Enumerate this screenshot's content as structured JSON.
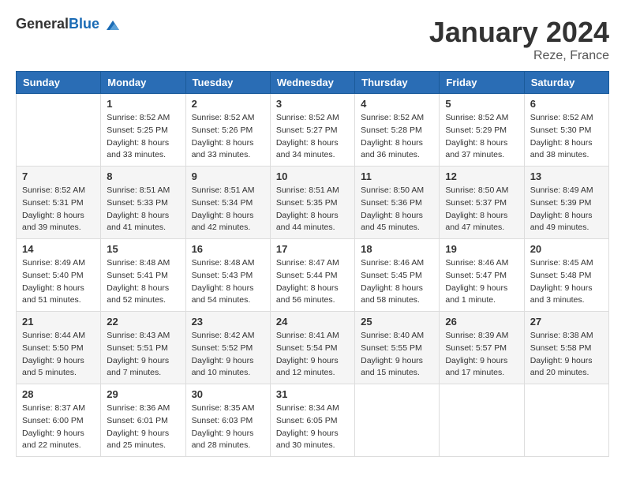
{
  "logo": {
    "general": "General",
    "blue": "Blue"
  },
  "title": "January 2024",
  "location": "Reze, France",
  "headers": [
    "Sunday",
    "Monday",
    "Tuesday",
    "Wednesday",
    "Thursday",
    "Friday",
    "Saturday"
  ],
  "weeks": [
    [
      {
        "day": "",
        "sunrise": "",
        "sunset": "",
        "daylight": ""
      },
      {
        "day": "1",
        "sunrise": "Sunrise: 8:52 AM",
        "sunset": "Sunset: 5:25 PM",
        "daylight": "Daylight: 8 hours and 33 minutes."
      },
      {
        "day": "2",
        "sunrise": "Sunrise: 8:52 AM",
        "sunset": "Sunset: 5:26 PM",
        "daylight": "Daylight: 8 hours and 33 minutes."
      },
      {
        "day": "3",
        "sunrise": "Sunrise: 8:52 AM",
        "sunset": "Sunset: 5:27 PM",
        "daylight": "Daylight: 8 hours and 34 minutes."
      },
      {
        "day": "4",
        "sunrise": "Sunrise: 8:52 AM",
        "sunset": "Sunset: 5:28 PM",
        "daylight": "Daylight: 8 hours and 36 minutes."
      },
      {
        "day": "5",
        "sunrise": "Sunrise: 8:52 AM",
        "sunset": "Sunset: 5:29 PM",
        "daylight": "Daylight: 8 hours and 37 minutes."
      },
      {
        "day": "6",
        "sunrise": "Sunrise: 8:52 AM",
        "sunset": "Sunset: 5:30 PM",
        "daylight": "Daylight: 8 hours and 38 minutes."
      }
    ],
    [
      {
        "day": "7",
        "sunrise": "Sunrise: 8:52 AM",
        "sunset": "Sunset: 5:31 PM",
        "daylight": "Daylight: 8 hours and 39 minutes."
      },
      {
        "day": "8",
        "sunrise": "Sunrise: 8:51 AM",
        "sunset": "Sunset: 5:33 PM",
        "daylight": "Daylight: 8 hours and 41 minutes."
      },
      {
        "day": "9",
        "sunrise": "Sunrise: 8:51 AM",
        "sunset": "Sunset: 5:34 PM",
        "daylight": "Daylight: 8 hours and 42 minutes."
      },
      {
        "day": "10",
        "sunrise": "Sunrise: 8:51 AM",
        "sunset": "Sunset: 5:35 PM",
        "daylight": "Daylight: 8 hours and 44 minutes."
      },
      {
        "day": "11",
        "sunrise": "Sunrise: 8:50 AM",
        "sunset": "Sunset: 5:36 PM",
        "daylight": "Daylight: 8 hours and 45 minutes."
      },
      {
        "day": "12",
        "sunrise": "Sunrise: 8:50 AM",
        "sunset": "Sunset: 5:37 PM",
        "daylight": "Daylight: 8 hours and 47 minutes."
      },
      {
        "day": "13",
        "sunrise": "Sunrise: 8:49 AM",
        "sunset": "Sunset: 5:39 PM",
        "daylight": "Daylight: 8 hours and 49 minutes."
      }
    ],
    [
      {
        "day": "14",
        "sunrise": "Sunrise: 8:49 AM",
        "sunset": "Sunset: 5:40 PM",
        "daylight": "Daylight: 8 hours and 51 minutes."
      },
      {
        "day": "15",
        "sunrise": "Sunrise: 8:48 AM",
        "sunset": "Sunset: 5:41 PM",
        "daylight": "Daylight: 8 hours and 52 minutes."
      },
      {
        "day": "16",
        "sunrise": "Sunrise: 8:48 AM",
        "sunset": "Sunset: 5:43 PM",
        "daylight": "Daylight: 8 hours and 54 minutes."
      },
      {
        "day": "17",
        "sunrise": "Sunrise: 8:47 AM",
        "sunset": "Sunset: 5:44 PM",
        "daylight": "Daylight: 8 hours and 56 minutes."
      },
      {
        "day": "18",
        "sunrise": "Sunrise: 8:46 AM",
        "sunset": "Sunset: 5:45 PM",
        "daylight": "Daylight: 8 hours and 58 minutes."
      },
      {
        "day": "19",
        "sunrise": "Sunrise: 8:46 AM",
        "sunset": "Sunset: 5:47 PM",
        "daylight": "Daylight: 9 hours and 1 minute."
      },
      {
        "day": "20",
        "sunrise": "Sunrise: 8:45 AM",
        "sunset": "Sunset: 5:48 PM",
        "daylight": "Daylight: 9 hours and 3 minutes."
      }
    ],
    [
      {
        "day": "21",
        "sunrise": "Sunrise: 8:44 AM",
        "sunset": "Sunset: 5:50 PM",
        "daylight": "Daylight: 9 hours and 5 minutes."
      },
      {
        "day": "22",
        "sunrise": "Sunrise: 8:43 AM",
        "sunset": "Sunset: 5:51 PM",
        "daylight": "Daylight: 9 hours and 7 minutes."
      },
      {
        "day": "23",
        "sunrise": "Sunrise: 8:42 AM",
        "sunset": "Sunset: 5:52 PM",
        "daylight": "Daylight: 9 hours and 10 minutes."
      },
      {
        "day": "24",
        "sunrise": "Sunrise: 8:41 AM",
        "sunset": "Sunset: 5:54 PM",
        "daylight": "Daylight: 9 hours and 12 minutes."
      },
      {
        "day": "25",
        "sunrise": "Sunrise: 8:40 AM",
        "sunset": "Sunset: 5:55 PM",
        "daylight": "Daylight: 9 hours and 15 minutes."
      },
      {
        "day": "26",
        "sunrise": "Sunrise: 8:39 AM",
        "sunset": "Sunset: 5:57 PM",
        "daylight": "Daylight: 9 hours and 17 minutes."
      },
      {
        "day": "27",
        "sunrise": "Sunrise: 8:38 AM",
        "sunset": "Sunset: 5:58 PM",
        "daylight": "Daylight: 9 hours and 20 minutes."
      }
    ],
    [
      {
        "day": "28",
        "sunrise": "Sunrise: 8:37 AM",
        "sunset": "Sunset: 6:00 PM",
        "daylight": "Daylight: 9 hours and 22 minutes."
      },
      {
        "day": "29",
        "sunrise": "Sunrise: 8:36 AM",
        "sunset": "Sunset: 6:01 PM",
        "daylight": "Daylight: 9 hours and 25 minutes."
      },
      {
        "day": "30",
        "sunrise": "Sunrise: 8:35 AM",
        "sunset": "Sunset: 6:03 PM",
        "daylight": "Daylight: 9 hours and 28 minutes."
      },
      {
        "day": "31",
        "sunrise": "Sunrise: 8:34 AM",
        "sunset": "Sunset: 6:05 PM",
        "daylight": "Daylight: 9 hours and 30 minutes."
      },
      {
        "day": "",
        "sunrise": "",
        "sunset": "",
        "daylight": ""
      },
      {
        "day": "",
        "sunrise": "",
        "sunset": "",
        "daylight": ""
      },
      {
        "day": "",
        "sunrise": "",
        "sunset": "",
        "daylight": ""
      }
    ]
  ]
}
